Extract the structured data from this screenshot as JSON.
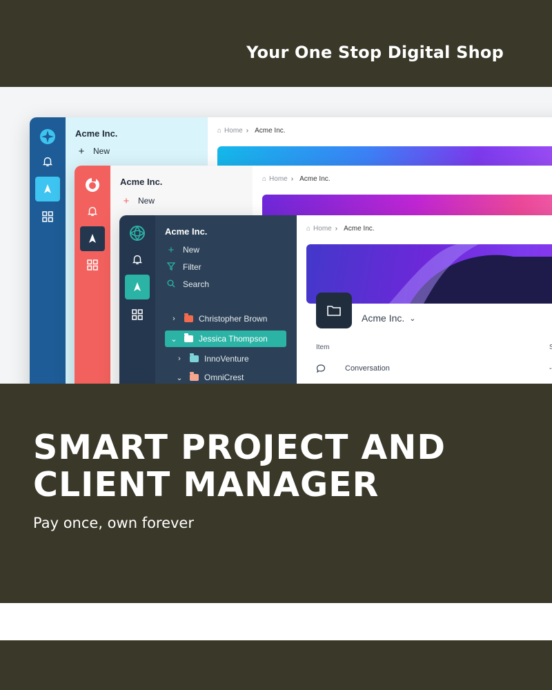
{
  "header": {
    "tagline": "Your One Stop Digital Shop"
  },
  "hero": {
    "headline_line1": "SMART PROJECT AND",
    "headline_line2": "CLIENT MANAGER",
    "subline": "Pay once, own forever"
  },
  "windows": {
    "back": {
      "org": "Acme Inc.",
      "new_label": "New",
      "breadcrumb_home": "Home",
      "breadcrumb_current": "Acme Inc."
    },
    "middle": {
      "org": "Acme Inc.",
      "new_label": "New",
      "breadcrumb_home": "Home",
      "breadcrumb_current": "Acme Inc."
    },
    "front": {
      "org": "Acme Inc.",
      "new_label": "New",
      "filter_label": "Filter",
      "search_label": "Search",
      "breadcrumb_home": "Home",
      "breadcrumb_current": "Acme Inc.",
      "workspace_title": "Acme Inc.",
      "tree": [
        {
          "label": "Christopher Brown"
        },
        {
          "label": "Jessica Thompson"
        },
        {
          "label": "InnoVenture"
        },
        {
          "label": "OmniCrest"
        }
      ],
      "table_header_item": "Item",
      "table_header_status": "S",
      "row_label": "Conversation",
      "row_status": "-"
    }
  },
  "colors": {
    "band": "#3a3828",
    "back_rail": "#1d5c96",
    "back_side": "#d9f4fb",
    "middle_rail": "#f2615d",
    "front_rail": "#24374e",
    "front_side": "#2c4157",
    "accent_teal": "#2bb3a6"
  }
}
